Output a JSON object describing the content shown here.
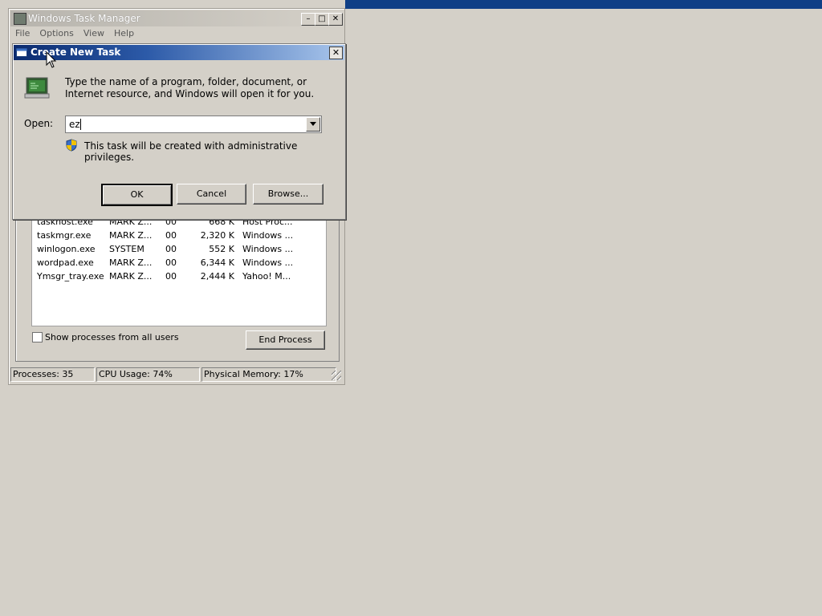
{
  "task_manager": {
    "title": "Windows Task Manager",
    "menu": [
      "File",
      "Options",
      "View",
      "Help"
    ],
    "processes": [
      {
        "name": "taskhost.exe",
        "user": "MARK Z...",
        "cpu": "00",
        "mem": "668 K",
        "desc": "Host Proc..."
      },
      {
        "name": "taskmgr.exe",
        "user": "MARK Z...",
        "cpu": "00",
        "mem": "2,320 K",
        "desc": "Windows ..."
      },
      {
        "name": "winlogon.exe",
        "user": "SYSTEM",
        "cpu": "00",
        "mem": "552 K",
        "desc": "Windows ..."
      },
      {
        "name": "wordpad.exe",
        "user": "MARK Z...",
        "cpu": "00",
        "mem": "6,344 K",
        "desc": "Windows ..."
      },
      {
        "name": "Ymsgr_tray.exe",
        "user": "MARK Z...",
        "cpu": "00",
        "mem": "2,444 K",
        "desc": "Yahoo! M..."
      }
    ],
    "show_all_label": "Show processes from all users",
    "end_process_label": "End Process",
    "status": {
      "processes": "Processes: 35",
      "cpu": "CPU Usage: 74%",
      "memory": "Physical Memory: 17%"
    }
  },
  "dialog": {
    "title": "Create New Task",
    "description": "Type the name of a program, folder, document, or Internet resource, and Windows will open it for you.",
    "open_label": "Open:",
    "open_value": "ez",
    "admin_note": "This task will be created with administrative privileges.",
    "ok_label": "OK",
    "cancel_label": "Cancel",
    "browse_label": "Browse..."
  },
  "colors": {
    "dialog_title_start": "#0a2a6e",
    "dialog_title_end": "#a9c6ec",
    "desktop": "#d4d0c8",
    "top_strip": "#0f3f86"
  }
}
